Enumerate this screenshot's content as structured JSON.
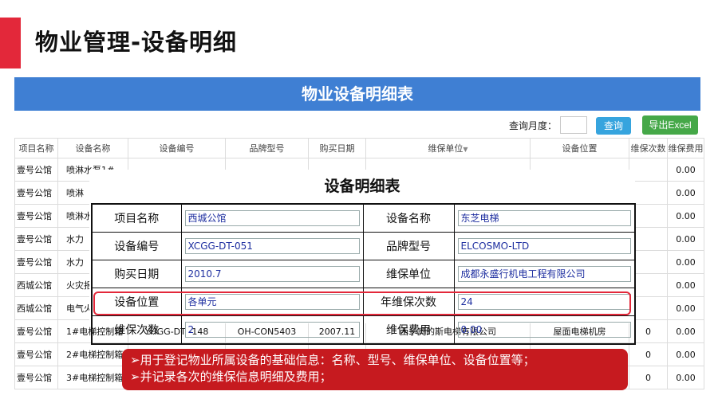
{
  "page_title": "物业管理-设备明细",
  "banner_title": "物业设备明细表",
  "toolbar": {
    "query_label": "查询月度：",
    "query_button": "查询",
    "export_button": "导出Excel"
  },
  "table": {
    "headers": [
      "项目名称",
      "设备名称",
      "设备编号",
      "品牌型号",
      "购买日期",
      "维保单位",
      "设备位置",
      "维保次数",
      "维保费用"
    ],
    "rows": [
      [
        "壹号公馆",
        "喷淋水泵1#",
        "",
        "",
        "",
        "",
        "",
        "",
        "0.00"
      ],
      [
        "壹号公馆",
        "喷淋",
        "",
        "",
        "",
        "",
        "",
        "",
        "0.00"
      ],
      [
        "壹号公馆",
        "喷淋水",
        "",
        "",
        "",
        "",
        "",
        "",
        "0.00"
      ],
      [
        "壹号公馆",
        "水力",
        "",
        "",
        "",
        "",
        "",
        "",
        "0.00"
      ],
      [
        "壹号公馆",
        "水力",
        "",
        "",
        "",
        "",
        "",
        "",
        "0.00"
      ],
      [
        "西城公馆",
        "火灾报",
        "",
        "",
        "",
        "",
        "",
        "",
        "0.00"
      ],
      [
        "西城公馆",
        "电气火",
        "",
        "",
        "",
        "",
        "",
        "",
        "0.00"
      ],
      [
        "壹号公馆",
        "1#电梯控制箱",
        "YHGG-DT -148",
        "OH-CON5403",
        "2007.11",
        "西子奥的斯电梯有限公司",
        "屋面电梯机房",
        "0",
        "0.00"
      ],
      [
        "壹号公馆",
        "2#电梯控制箱",
        "",
        "",
        "",
        "",
        "",
        "0",
        "0.00"
      ],
      [
        "壹号公馆",
        "3#电梯控制箱",
        "",
        "",
        "",
        "",
        "",
        "0",
        "0.00"
      ]
    ]
  },
  "detail": {
    "title": "设备明细表",
    "project_label": "项目名称",
    "project_value": "西城公馆",
    "device_name_label": "设备名称",
    "device_name_value": "东芝电梯",
    "device_no_label": "设备编号",
    "device_no_value": "XCGG-DT-051",
    "brand_label": "品牌型号",
    "brand_value": "ELCOSMO-LTD",
    "purchase_label": "购买日期",
    "purchase_value": "2010.7",
    "vendor_label": "维保单位",
    "vendor_value": "成都永盛行机电工程有限公司",
    "location_label": "设备位置",
    "location_value": "各单元",
    "annual_label": "年维保次数",
    "annual_value": "24",
    "count_label": "维保次数",
    "count_value": "2",
    "fee_label": "维保费用",
    "fee_value": "0.00"
  },
  "note": {
    "line1": "➢用于登记物业所属设备的基础信息：名称、型号、维保单位、设备位置等；",
    "line2": "➢并记录各次的维保信息明细及费用；"
  },
  "colors": {
    "accent": "#e3283a",
    "banner": "#3f7fd3",
    "query_button": "#36a4de",
    "export_button": "#45a848",
    "note_bg": "#c61a1f"
  }
}
